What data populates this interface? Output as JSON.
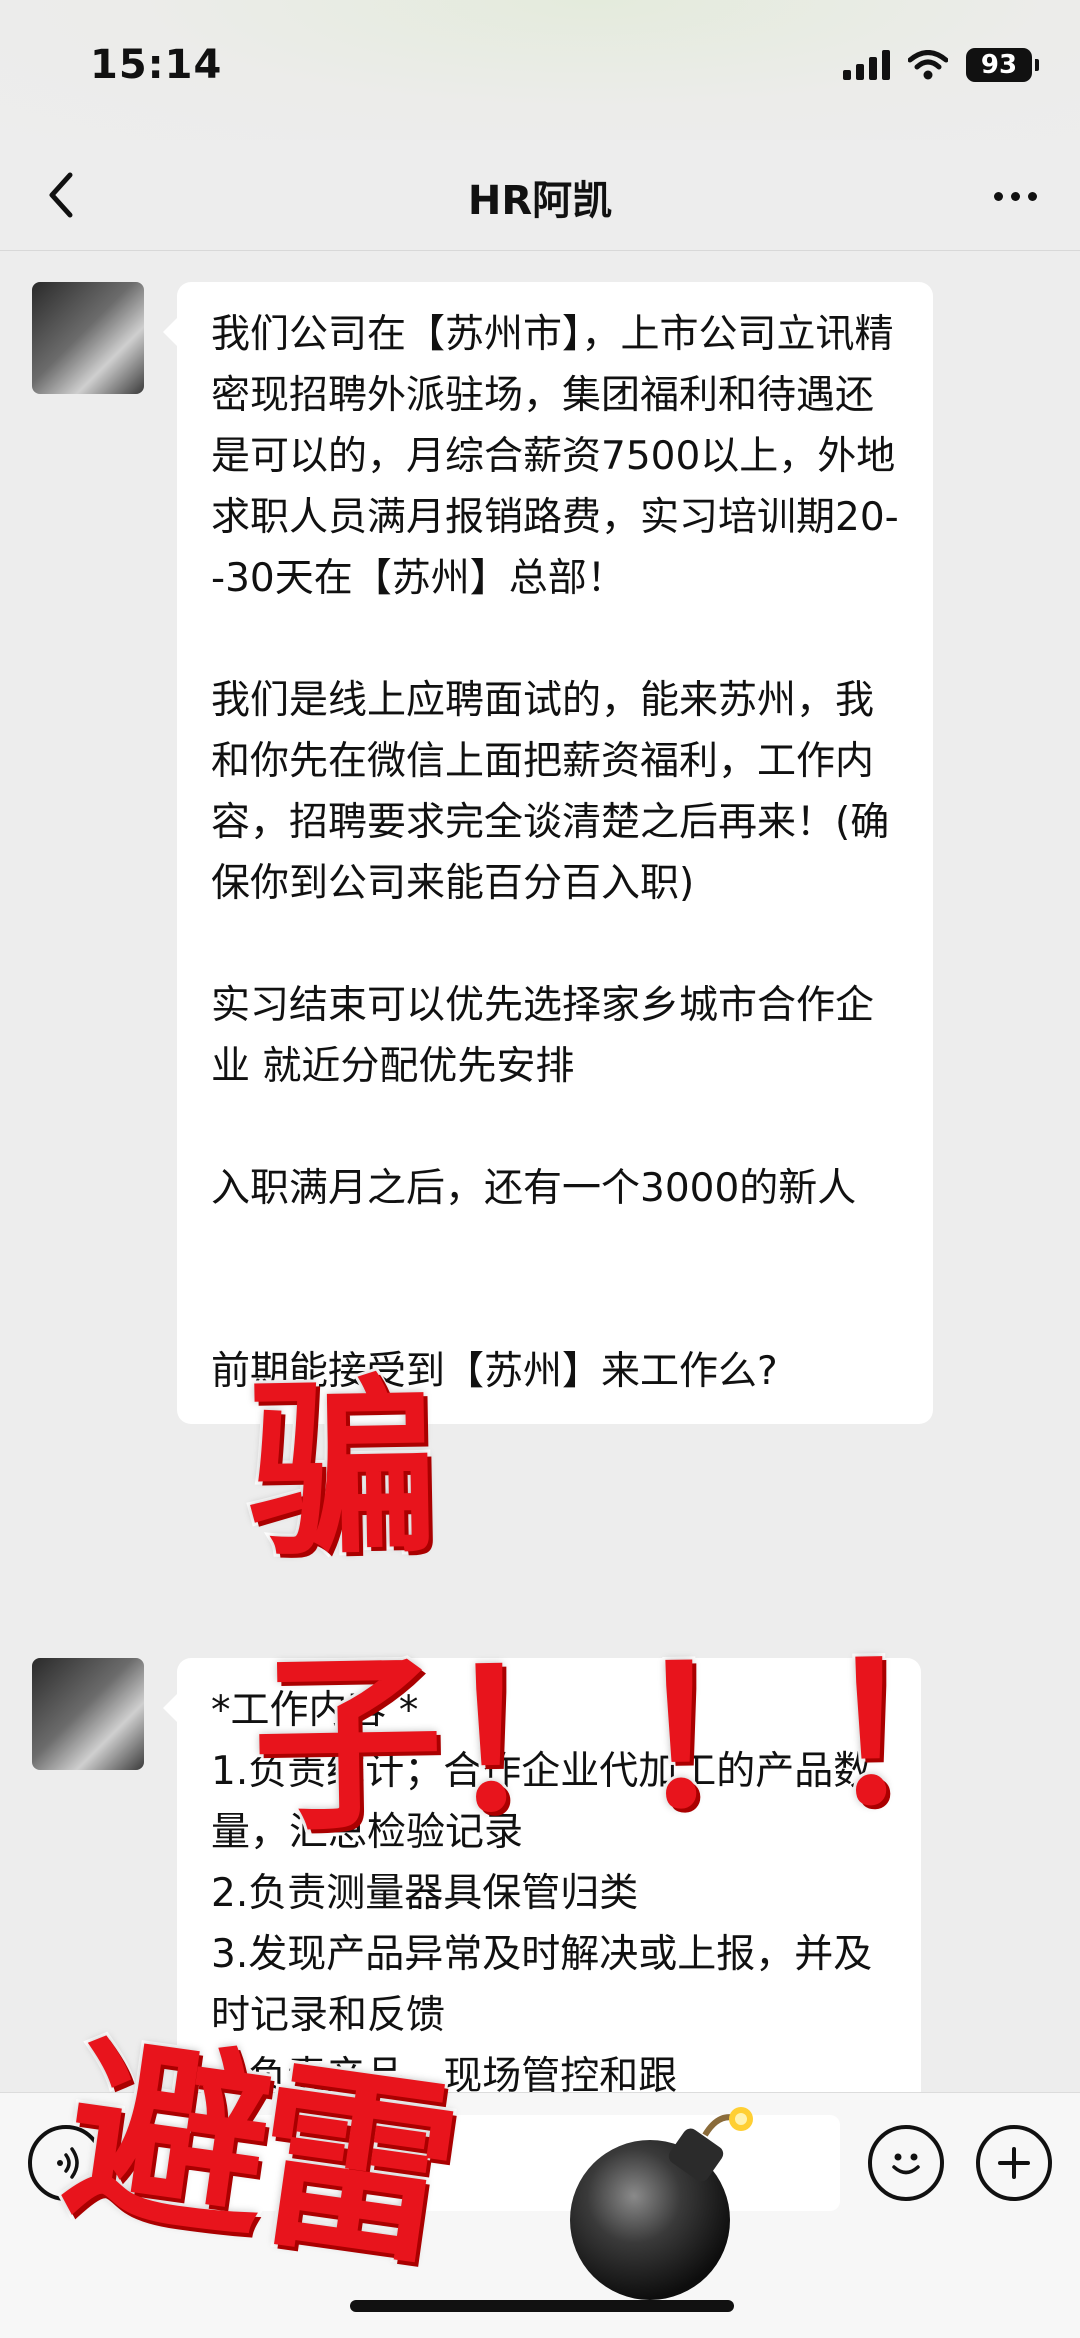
{
  "status_bar": {
    "time": "15:14",
    "battery": "93"
  },
  "nav": {
    "title": "HR阿凯",
    "back_icon": "chevron-left-icon",
    "more_icon": "ellipsis-icon"
  },
  "messages": [
    {
      "paragraphs": [
        "我们公司在【苏州市】，上市公司立讯精密现招聘外派驻场，集团福利和待遇还是可以的，月综合薪资7500以上，外地求职人员满月报销路费，实习培训期20--30天在【苏州】总部！",
        "我们是线上应聘面试的，能来苏州，我和你先在微信上面把薪资福利，工作内容，招聘要求完全谈清楚之后再来！(确保你到公司来能百分百入职)",
        "实习结束可以优先选择家乡城市合作企业 就近分配优先安排",
        "入职满月之后，还有一个3000的新人",
        "前期能接受到【苏州】来工作么?"
      ]
    },
    {
      "lines": [
        "*工作内容 *",
        "1.负责统计；合作企业代加工的产品数量，汇总检验记录",
        "2.负责测量器具保管归类",
        "3.发现产品异常及时解决或上报，并及时记录和反馈",
        "4.负责产品，现场管控和跟"
      ]
    }
  ],
  "overlays": {
    "scam": "骗子！！！",
    "avoid": "避雷",
    "bomb": "bomb-icon"
  },
  "input_bar": {
    "voice_icon": "voice-icon",
    "emoji_icon": "emoji-icon",
    "plus_icon": "plus-icon"
  },
  "colors": {
    "background": "#ededed",
    "bubble": "#ffffff",
    "overlay_red": "#e8141c"
  }
}
